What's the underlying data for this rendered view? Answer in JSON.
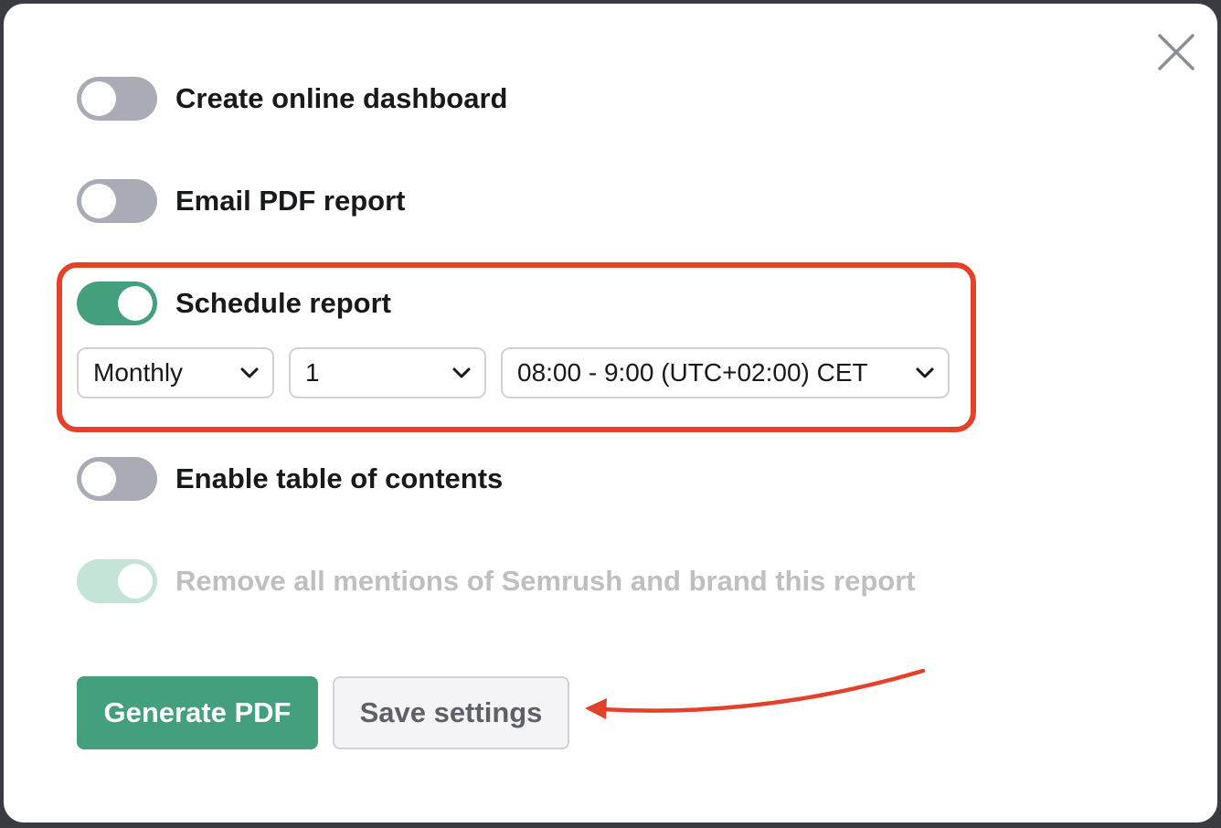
{
  "modal": {
    "close_label": "close"
  },
  "toggles": [
    {
      "label": "Create online dashboard",
      "state": "off"
    },
    {
      "label": "Email PDF report",
      "state": "off"
    },
    {
      "label": "Schedule report",
      "state": "on"
    },
    {
      "label": "Enable table of contents",
      "state": "off"
    },
    {
      "label": "Remove all mentions of Semrush and brand this report",
      "state": "on-disabled"
    }
  ],
  "schedule": {
    "frequency": {
      "value": "Monthly",
      "icon": "chevron-down-icon"
    },
    "day": {
      "value": "1",
      "icon": "chevron-down-icon"
    },
    "time": {
      "value": "08:00 - 9:00 (UTC+02:00) CET",
      "icon": "chevron-down-icon"
    }
  },
  "buttons": {
    "generate_label": "Generate PDF",
    "save_label": "Save settings"
  },
  "colors": {
    "accent_green": "#44a07c",
    "toggle_off": "#a9acb4",
    "toggle_disabled": "#c5e4d8",
    "annotation_red": "#e4412a"
  }
}
